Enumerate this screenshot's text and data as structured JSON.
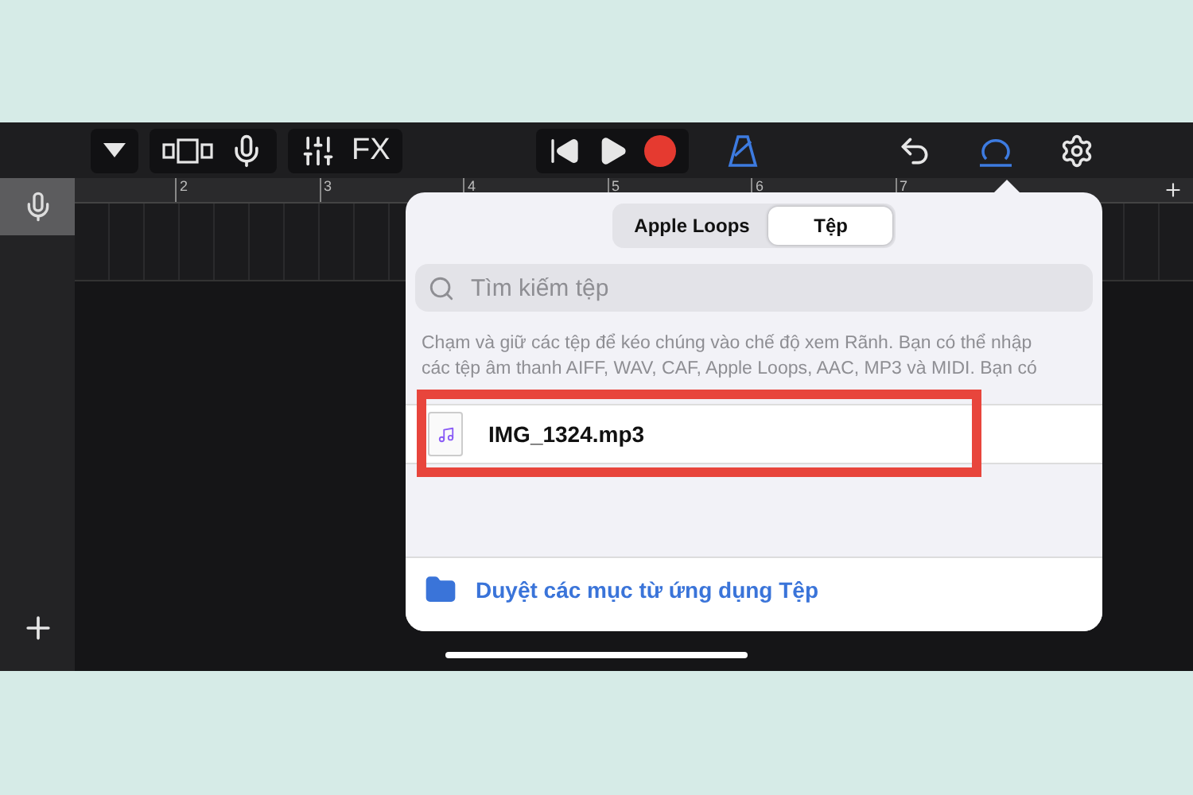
{
  "toolbar": {
    "fx_label": "FX",
    "metronome_on": true,
    "loops_browser_on": true
  },
  "ruler": [
    "2",
    "3",
    "4",
    "5",
    "6",
    "7"
  ],
  "popover": {
    "tabs": [
      {
        "label": "Apple Loops",
        "selected": false
      },
      {
        "label": "Tệp",
        "selected": true
      }
    ],
    "search": {
      "placeholder": "Tìm kiếm tệp"
    },
    "description": "Chạm và giữ các tệp để kéo chúng vào chế độ xem Rãnh. Bạn có thể nhập các tệp âm thanh AIFF, WAV, CAF, Apple Loops, AAC, MP3 và MIDI. Bạn có",
    "files": [
      {
        "name": "IMG_1324.mp3",
        "highlighted": true
      }
    ],
    "browse_link": "Duyệt các mục từ ứng dụng Tệp"
  }
}
